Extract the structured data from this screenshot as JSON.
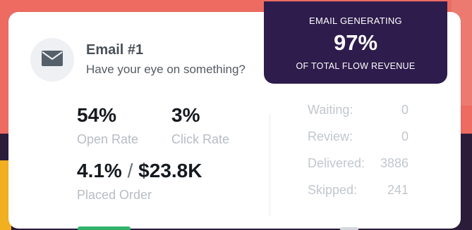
{
  "email": {
    "icon": "envelope-icon",
    "title": "Email #1",
    "subtitle": "Have your eye on something?"
  },
  "banner": {
    "top_text": "EMAIL GENERATING",
    "percent": "97%",
    "bottom_text": "OF TOTAL FLOW REVENUE"
  },
  "metrics": {
    "open_rate": {
      "value": "54%",
      "label": "Open Rate"
    },
    "click_rate": {
      "value": "3%",
      "label": "Click Rate"
    },
    "placed_order": {
      "rate": "4.1%",
      "separator": "/",
      "revenue": "$23.8K",
      "label": "Placed Order"
    }
  },
  "status": [
    {
      "label": "Waiting:",
      "value": "0"
    },
    {
      "label": "Review:",
      "value": "0"
    },
    {
      "label": "Delivered:",
      "value": "3886"
    },
    {
      "label": "Skipped:",
      "value": "241"
    }
  ],
  "colors": {
    "banner_bg": "#2e1c4c",
    "background_coral": "#ee6b62",
    "background_dark": "#2b1c3a",
    "accent_green": "#2fb36a"
  }
}
